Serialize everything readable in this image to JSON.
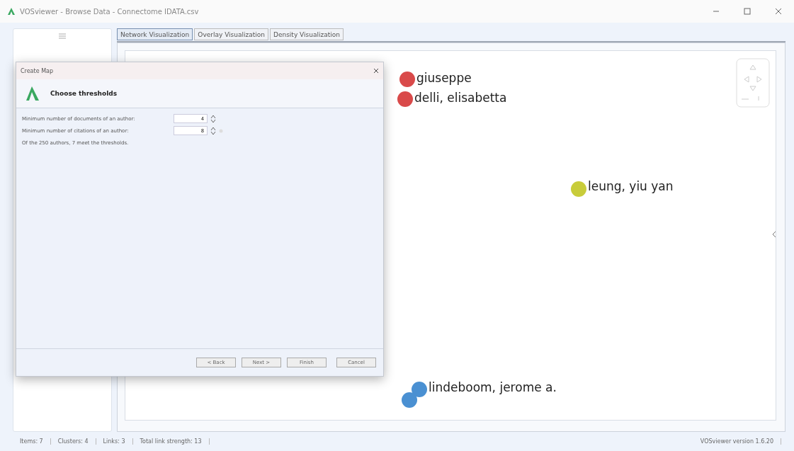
{
  "window": {
    "title": "VOSviewer - Browse Data - Connectome IDATA.csv"
  },
  "tabs": [
    {
      "label": "Network Visualization",
      "selected": true
    },
    {
      "label": "Overlay Visualization",
      "selected": false
    },
    {
      "label": "Density Visualization",
      "selected": false
    }
  ],
  "map": {
    "nodes": [
      {
        "label": "giuseppe",
        "color": "#d94a4a"
      },
      {
        "label": "delli, elisabetta",
        "color": "#d94a4a"
      },
      {
        "label": "leung, yiu yan",
        "color": "#c8cc3a"
      },
      {
        "label": "lindeboom, jerome a.",
        "color": "#4a90d2"
      },
      {
        "color": "#4a90d2"
      }
    ]
  },
  "dialog": {
    "title": "Create Map",
    "heading": "Choose thresholds",
    "fields": [
      {
        "label": "Minimum number of documents of an author:",
        "value": "4"
      },
      {
        "label": "Minimum number of citations of an author:",
        "value": "8"
      }
    ],
    "summary": "Of the 250 authors, 7 meet the thresholds.",
    "buttons": [
      "< Back",
      "Next >",
      "Finish",
      "Cancel"
    ]
  },
  "status_bar": {
    "items": [
      "Items: 7",
      "Clusters: 4",
      "Links: 3",
      "Total link strength: 13"
    ],
    "version": "VOSviewer version 1.6.20"
  }
}
